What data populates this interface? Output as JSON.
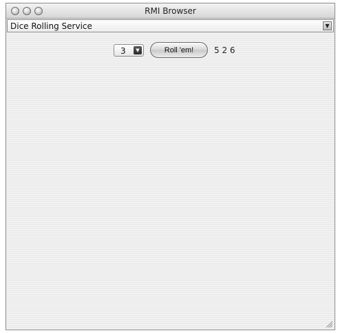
{
  "window": {
    "title": "RMI Browser"
  },
  "service_select": {
    "selected": "Dice Rolling Service"
  },
  "dice_select": {
    "selected": "3"
  },
  "roll_button": {
    "label": "Roll 'em!"
  },
  "result": {
    "text": "5 2 6",
    "values": [
      5,
      2,
      6
    ]
  },
  "icons": {
    "close": "close-button-icon",
    "minimize": "minimize-button-icon",
    "zoom": "zoom-button-icon",
    "dropdown": "chevron-down-icon",
    "resize": "resize-grip-icon"
  }
}
